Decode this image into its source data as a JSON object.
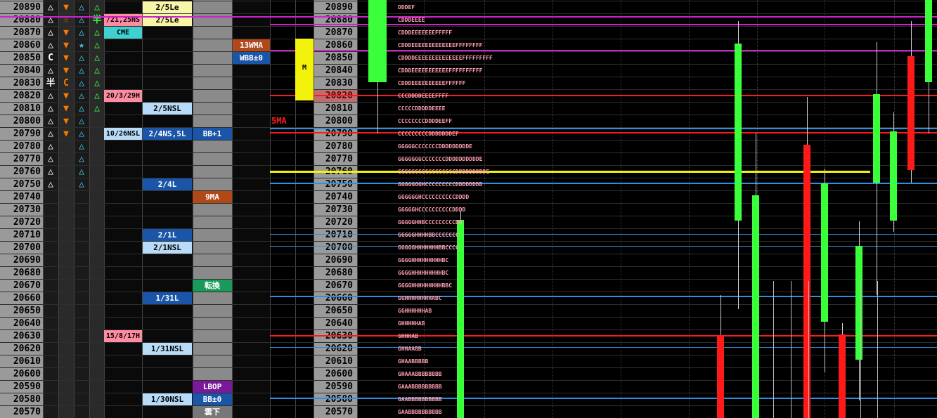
{
  "prices": [
    20890,
    20880,
    20870,
    20860,
    20850,
    20840,
    20830,
    20820,
    20810,
    20800,
    20790,
    20780,
    20770,
    20760,
    20750,
    20740,
    20730,
    20720,
    20710,
    20700,
    20690,
    20680,
    20670,
    20660,
    20650,
    20640,
    20630,
    20620,
    20610,
    20600,
    20590,
    20580,
    20570
  ],
  "colors": {
    "orange": "#ff7a00",
    "cyan": "#40c8e8",
    "green": "#3cff3c",
    "red": "#ff1a1a",
    "magenta": "#d020d0",
    "yellow": "#f2f20a",
    "blue": "#2f8fe0",
    "tpo": "#ff9fb0",
    "lightblue": "#b8dcf8",
    "darkblue": "#1a55a8",
    "pink": "#ff8ca0",
    "lightyellow": "#f8f4a8",
    "teal": "#40d0d0",
    "brown": "#b04818",
    "purple": "#7a1a9a",
    "darkgreen": "#1a9a5a"
  },
  "symbols": [
    [
      "△",
      "▼",
      "△",
      "△"
    ],
    [
      "△",
      "☆",
      "△",
      "半"
    ],
    [
      "△",
      "▼",
      "△",
      "△"
    ],
    [
      "△",
      "▼",
      "★",
      "△"
    ],
    [
      "C",
      "▼",
      "△",
      "△"
    ],
    [
      "△",
      "▼",
      "△",
      "△"
    ],
    [
      "半",
      "C",
      "△",
      "△"
    ],
    [
      "△",
      "▼",
      "△",
      "△"
    ],
    [
      "△",
      "▼",
      "△",
      "△"
    ],
    [
      "△",
      "▼",
      "△",
      ""
    ],
    [
      "△",
      "▼",
      "△",
      ""
    ],
    [
      "△",
      "",
      "△",
      ""
    ],
    [
      "△",
      "",
      "△",
      ""
    ],
    [
      "△",
      "",
      "△",
      ""
    ],
    [
      "△",
      "",
      "△",
      ""
    ]
  ],
  "col_d": [
    {
      "row": 1,
      "text": "/21,25NS",
      "bg": "#ff8ca0"
    },
    {
      "row": 2,
      "text": "CME",
      "bg": "#40d0d0"
    },
    {
      "row": 7,
      "text": "20/3/29H",
      "bg": "#ff8ca0"
    },
    {
      "row": 10,
      "text": "10/26NSL",
      "bg": "#b8dcf8"
    },
    {
      "row": 26,
      "text": "15/8/17H",
      "bg": "#ff8ca0"
    }
  ],
  "col_e": [
    {
      "row": 0,
      "text": "2/5Le",
      "style": "ly"
    },
    {
      "row": 1,
      "text": "2/5Le",
      "style": "ly"
    },
    {
      "row": 8,
      "text": "2/5NSL",
      "style": "lb"
    },
    {
      "row": 10,
      "text": "2/4NS,5L",
      "style": "db"
    },
    {
      "row": 14,
      "text": "2/4L",
      "style": "db"
    },
    {
      "row": 18,
      "text": "2/1L",
      "style": "db"
    },
    {
      "row": 19,
      "text": "2/1NSL",
      "style": "lb"
    },
    {
      "row": 23,
      "text": "1/31L",
      "style": "db"
    },
    {
      "row": 27,
      "text": "1/31NSL",
      "style": "lb"
    },
    {
      "row": 31,
      "text": "1/30NSL",
      "style": "lb"
    }
  ],
  "col_f": [
    {
      "row": 10,
      "text": "BB+1",
      "bg": "#1a55a8"
    },
    {
      "row": 15,
      "text": "9MA",
      "bg": "#b04818"
    },
    {
      "row": 22,
      "text": "転換",
      "bg": "#1a9a5a"
    },
    {
      "row": 30,
      "text": "LBOP",
      "bg": "#7a1a9a"
    },
    {
      "row": 31,
      "text": "BB±0",
      "bg": "#1a55a8"
    },
    {
      "row": 32,
      "text": "雲下",
      "bg": "#777777"
    }
  ],
  "col_g": [
    {
      "row": 3,
      "text": "13WMA",
      "bg": "#b04818"
    },
    {
      "row": 4,
      "text": "WBB±0",
      "bg": "#1a55a8"
    }
  ],
  "ma5_label": "5MA",
  "m_label": "M",
  "tpo_rows": [
    {
      "row": 0,
      "text": "DDDEF"
    },
    {
      "row": 1,
      "text": "CDDDEEEE"
    },
    {
      "row": 2,
      "text": "CDDDEEEEEEEFFFFF"
    },
    {
      "row": 3,
      "text": "CDDDEEEEEEEEEEEEEFFFFFFFF"
    },
    {
      "row": 4,
      "text": "CDDDDEEEEEEEEEEEEEEFFFFFFFFF"
    },
    {
      "row": 5,
      "text": "CDDDEEEEEEEEEEEFFFFFFFFFF"
    },
    {
      "row": 6,
      "text": "CDDDEEEEEEEEEEFFFFFF"
    },
    {
      "row": 7,
      "text": "CCCDDDDEEEEFFFF"
    },
    {
      "row": 8,
      "text": "CCCCCDDDDDEEEE"
    },
    {
      "row": 9,
      "text": "CCCCCCCCDDDDEEFF"
    },
    {
      "row": 10,
      "text": "CCCCCCCCCDDDDDDDEF"
    },
    {
      "row": 11,
      "text": "GGGGGCCCCCCCDDDDDDDDDE"
    },
    {
      "row": 12,
      "text": "GGGGGGGCCCCCCCDDDDDDDDDDE"
    },
    {
      "row": 13,
      "text": "GGGGGGGGCCCCCCCCCDDDDDDDDDE"
    },
    {
      "row": 14,
      "text": "GGGGGGGHCCCCCCCCCDDDDDDDD"
    },
    {
      "row": 15,
      "text": "GGGGGGHCCCCCCCCCCDDDD"
    },
    {
      "row": 16,
      "text": "GGGGGHCCCCCCCCCCDDDD"
    },
    {
      "row": 17,
      "text": "GGGGGHHBCCCCCCCCCDD"
    },
    {
      "row": 18,
      "text": "GGGGGHHHHBBCCCCCCC"
    },
    {
      "row": 19,
      "text": "GGGGGHHHHHHHBBCCCC"
    },
    {
      "row": 20,
      "text": "GGGGHHHHHHHHHBC"
    },
    {
      "row": 21,
      "text": "GGGGHHHHHHHHHBC"
    },
    {
      "row": 22,
      "text": "GGGGHHHHHHHHHBBC"
    },
    {
      "row": 23,
      "text": "GGHHHHHHHHABC"
    },
    {
      "row": 24,
      "text": "GGHHHHHHAB"
    },
    {
      "row": 25,
      "text": "GHHHHHAB"
    },
    {
      "row": 26,
      "text": "GHHHAB"
    },
    {
      "row": 27,
      "text": "GHHAABB"
    },
    {
      "row": 28,
      "text": "GHAABBBBB"
    },
    {
      "row": 29,
      "text": "GHAAABBBBBBBB"
    },
    {
      "row": 30,
      "text": "GAAABBBBBBBBB"
    },
    {
      "row": 31,
      "text": "GAABBBBBBBBBB"
    },
    {
      "row": 32,
      "text": "GAABBBBBBBBBB"
    }
  ]
}
